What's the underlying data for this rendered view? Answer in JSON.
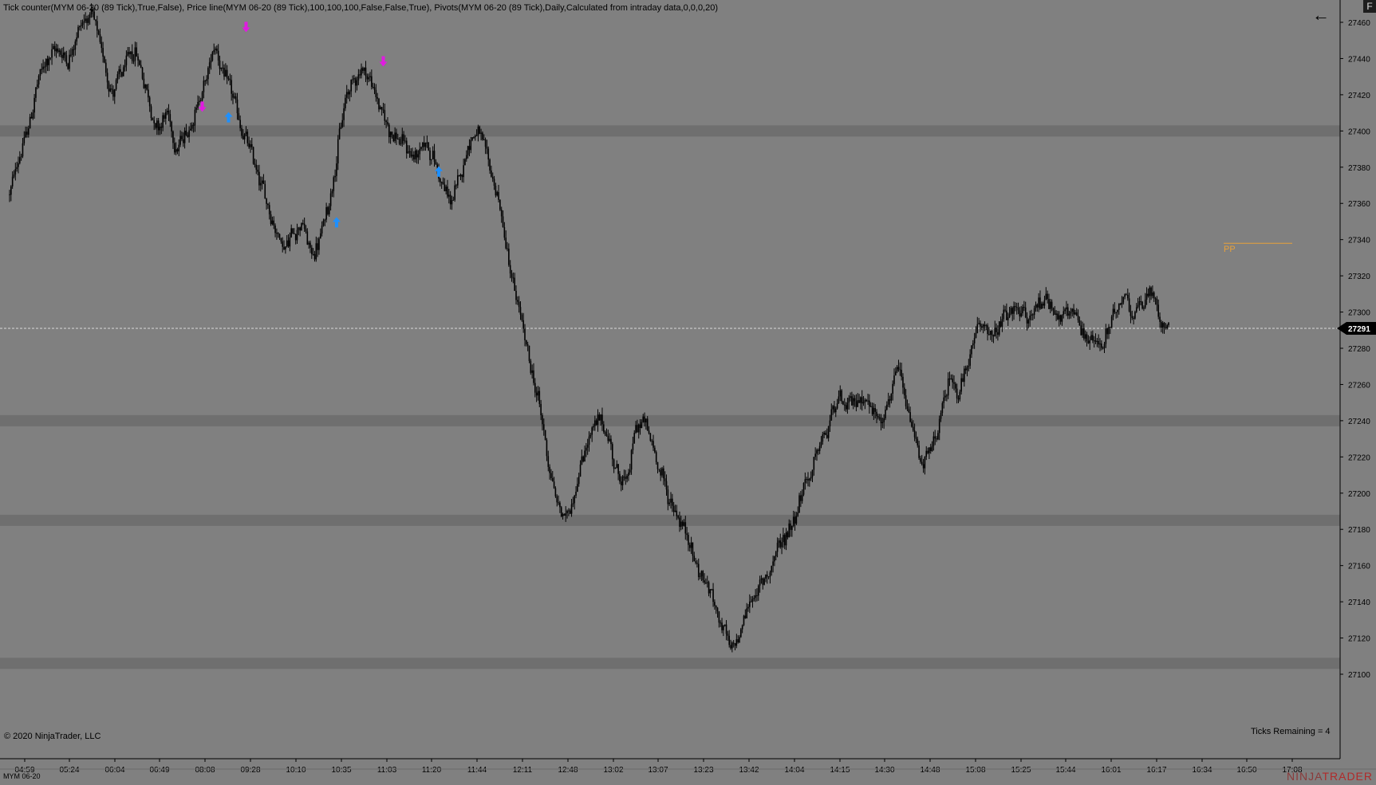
{
  "header": {
    "indicators_text": "Tick counter(MYM 06-20 (89 Tick),True,False), Price line(MYM 06-20 (89 Tick),100,100,100,False,False,True), Pivots(MYM 06-20 (89 Tick),Daily,Calculated from intraday data,0,0,0,20)"
  },
  "corner_button": {
    "label": "F"
  },
  "back_arrow": {
    "glyph": "←",
    "icon": "arrow-left-icon"
  },
  "copyright": "© 2020 NinjaTrader, LLC",
  "ticks_remaining": "Ticks Remaining = 4",
  "instrument_label": "MYM 06-20",
  "brand": {
    "prefix": "NINJA",
    "suffix": "TRADER"
  },
  "current_price": {
    "label": "27291",
    "value": 27291
  },
  "pivot": {
    "label": "PP",
    "value": 27338,
    "color": "#e8a13a"
  },
  "colors": {
    "background": "#808080",
    "band": "#6f6f6f",
    "candle": "#000000",
    "down_signal": "#e01ce0",
    "up_signal": "#1e90ff"
  },
  "chart_data": {
    "type": "candlestick",
    "instrument": "MYM 06-20",
    "bar_type": "89 Tick",
    "y_ticks": [
      27460,
      27440,
      27420,
      27400,
      27380,
      27360,
      27340,
      27320,
      27300,
      27280,
      27260,
      27240,
      27220,
      27200,
      27180,
      27160,
      27140,
      27120,
      27100
    ],
    "ylim": [
      27097,
      27465
    ],
    "x_ticks": [
      "04:59",
      "05:24",
      "06:04",
      "06:49",
      "08:08",
      "09:28",
      "10:10",
      "10:35",
      "11:03",
      "11:20",
      "11:44",
      "12:11",
      "12:48",
      "13:02",
      "13:07",
      "13:23",
      "13:42",
      "14:04",
      "14:15",
      "14:30",
      "14:48",
      "15:08",
      "15:25",
      "15:44",
      "16:01",
      "16:17",
      "16:34",
      "16:50",
      "17:08"
    ],
    "price_bands": [
      27400,
      27240,
      27185,
      27106
    ],
    "price_anchors": [
      [
        0,
        27365
      ],
      [
        5,
        27385
      ],
      [
        12,
        27400
      ],
      [
        18,
        27425
      ],
      [
        25,
        27440
      ],
      [
        32,
        27445
      ],
      [
        40,
        27440
      ],
      [
        48,
        27460
      ],
      [
        55,
        27465
      ],
      [
        62,
        27445
      ],
      [
        70,
        27420
      ],
      [
        78,
        27435
      ],
      [
        86,
        27445
      ],
      [
        94,
        27420
      ],
      [
        100,
        27400
      ],
      [
        107,
        27410
      ],
      [
        114,
        27390
      ],
      [
        121,
        27400
      ],
      [
        128,
        27415
      ],
      [
        135,
        27430
      ],
      [
        140,
        27450
      ],
      [
        146,
        27430
      ],
      [
        152,
        27420
      ],
      [
        158,
        27400
      ],
      [
        164,
        27390
      ],
      [
        170,
        27375
      ],
      [
        176,
        27360
      ],
      [
        182,
        27345
      ],
      [
        188,
        27335
      ],
      [
        194,
        27345
      ],
      [
        200,
        27350
      ],
      [
        206,
        27330
      ],
      [
        212,
        27340
      ],
      [
        218,
        27360
      ],
      [
        224,
        27390
      ],
      [
        230,
        27420
      ],
      [
        236,
        27430
      ],
      [
        242,
        27435
      ],
      [
        248,
        27425
      ],
      [
        254,
        27410
      ],
      [
        260,
        27400
      ],
      [
        266,
        27395
      ],
      [
        272,
        27390
      ],
      [
        278,
        27385
      ],
      [
        284,
        27395
      ],
      [
        290,
        27385
      ],
      [
        296,
        27370
      ],
      [
        302,
        27360
      ],
      [
        308,
        27375
      ],
      [
        314,
        27395
      ],
      [
        320,
        27400
      ],
      [
        326,
        27385
      ],
      [
        332,
        27370
      ],
      [
        338,
        27345
      ],
      [
        344,
        27315
      ],
      [
        350,
        27295
      ],
      [
        356,
        27270
      ],
      [
        362,
        27250
      ],
      [
        368,
        27220
      ],
      [
        374,
        27195
      ],
      [
        380,
        27185
      ],
      [
        386,
        27200
      ],
      [
        392,
        27220
      ],
      [
        398,
        27235
      ],
      [
        404,
        27240
      ],
      [
        410,
        27230
      ],
      [
        416,
        27210
      ],
      [
        422,
        27205
      ],
      [
        428,
        27235
      ],
      [
        434,
        27240
      ],
      [
        440,
        27225
      ],
      [
        446,
        27210
      ],
      [
        452,
        27195
      ],
      [
        458,
        27185
      ],
      [
        464,
        27175
      ],
      [
        470,
        27160
      ],
      [
        476,
        27150
      ],
      [
        482,
        27140
      ],
      [
        488,
        27125
      ],
      [
        494,
        27110
      ],
      [
        500,
        27125
      ],
      [
        506,
        27140
      ],
      [
        512,
        27145
      ],
      [
        518,
        27155
      ],
      [
        524,
        27165
      ],
      [
        530,
        27175
      ],
      [
        536,
        27185
      ],
      [
        542,
        27200
      ],
      [
        548,
        27210
      ],
      [
        554,
        27225
      ],
      [
        560,
        27235
      ],
      [
        566,
        27255
      ],
      [
        572,
        27245
      ],
      [
        578,
        27250
      ],
      [
        584,
        27255
      ],
      [
        590,
        27245
      ],
      [
        596,
        27240
      ],
      [
        602,
        27250
      ],
      [
        608,
        27270
      ],
      [
        614,
        27245
      ],
      [
        620,
        27230
      ],
      [
        626,
        27215
      ],
      [
        632,
        27225
      ],
      [
        638,
        27245
      ],
      [
        644,
        27265
      ],
      [
        650,
        27255
      ],
      [
        656,
        27270
      ],
      [
        662,
        27290
      ],
      [
        668,
        27295
      ],
      [
        674,
        27285
      ],
      [
        680,
        27295
      ],
      [
        686,
        27300
      ],
      [
        692,
        27300
      ],
      [
        698,
        27295
      ],
      [
        704,
        27305
      ],
      [
        710,
        27310
      ],
      [
        716,
        27300
      ],
      [
        722,
        27295
      ],
      [
        728,
        27300
      ],
      [
        734,
        27290
      ],
      [
        740,
        27285
      ],
      [
        746,
        27280
      ],
      [
        752,
        27290
      ],
      [
        758,
        27300
      ],
      [
        764,
        27310
      ],
      [
        770,
        27300
      ],
      [
        776,
        27305
      ],
      [
        782,
        27310
      ],
      [
        788,
        27296
      ],
      [
        794,
        27290
      ]
    ],
    "bar_count": 795,
    "signals": [
      {
        "type": "down",
        "bar": 162,
        "price": 27455
      },
      {
        "type": "down",
        "bar": 132,
        "price": 27411
      },
      {
        "type": "down",
        "bar": 256,
        "price": 27436
      },
      {
        "type": "up",
        "bar": 150,
        "price": 27410
      },
      {
        "type": "up",
        "bar": 224,
        "price": 27352
      },
      {
        "type": "up",
        "bar": 294,
        "price": 27380
      }
    ]
  }
}
